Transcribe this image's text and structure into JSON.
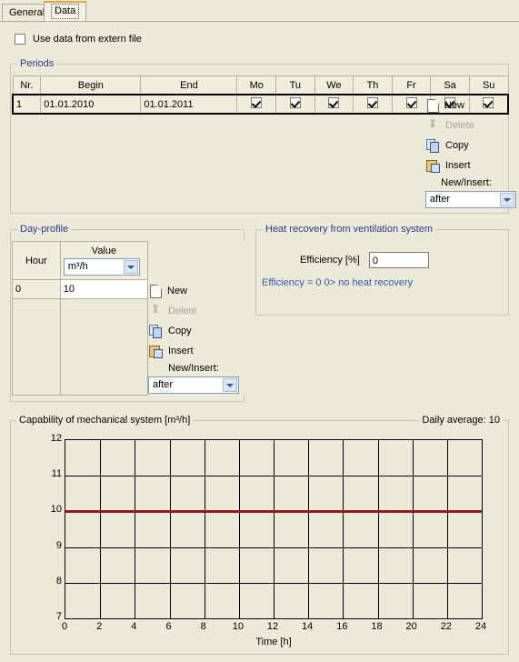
{
  "tabs": [
    {
      "label": "General",
      "active": false
    },
    {
      "label": "Data",
      "active": true
    }
  ],
  "extern": {
    "label": "Use data from extern file",
    "checked": false
  },
  "periods": {
    "legend": "Periods",
    "columns": [
      "Nr.",
      "Begin",
      "End",
      "Mo",
      "Tu",
      "We",
      "Th",
      "Fr",
      "Sa",
      "Su"
    ],
    "rows": [
      {
        "nr": "1",
        "begin": "01.01.2010",
        "end": "01.01.2011",
        "days": [
          true,
          true,
          true,
          true,
          true,
          true,
          true
        ],
        "selected": true
      }
    ],
    "actions": [
      {
        "label": "New",
        "icon": "new-page-icon",
        "enabled": true
      },
      {
        "label": "Delete",
        "icon": "scissors-icon",
        "enabled": false
      },
      {
        "label": "Copy",
        "icon": "copy-icon",
        "enabled": true
      },
      {
        "label": "Insert",
        "icon": "clipboard-insert-icon",
        "enabled": true
      }
    ],
    "new_insert_label": "New/Insert:",
    "new_insert_value": "after"
  },
  "dayprofile": {
    "legend": "Day-profile",
    "columns": [
      "Hour",
      "Value"
    ],
    "unit_value": "m³/h",
    "rows": [
      {
        "hour": "0",
        "value": "10"
      }
    ],
    "actions": [
      {
        "label": "New",
        "icon": "new-page-icon",
        "enabled": true
      },
      {
        "label": "Delete",
        "icon": "scissors-icon",
        "enabled": false
      },
      {
        "label": "Copy",
        "icon": "copy-icon",
        "enabled": true
      },
      {
        "label": "Insert",
        "icon": "clipboard-insert-icon",
        "enabled": true
      }
    ],
    "new_insert_label": "New/Insert:",
    "new_insert_value": "after"
  },
  "heat_recovery": {
    "legend": "Heat recovery from ventilation system",
    "efficiency_label": "Efficiency  [%]",
    "efficiency_value": "0",
    "note": "Efficiency = 0 0> no heat recovery"
  },
  "chart_panel": {
    "title": "Capability of mechanical system [m³/h]",
    "daily_average_label": "Daily average: 10"
  },
  "chart_data": {
    "type": "line",
    "title": "Capability of mechanical system [m³/h]",
    "xlabel": "Time [h]",
    "ylabel": "",
    "xlim": [
      0,
      24
    ],
    "ylim": [
      7,
      12
    ],
    "xticks": [
      0,
      2,
      4,
      6,
      8,
      10,
      12,
      14,
      16,
      18,
      20,
      22,
      24
    ],
    "yticks": [
      7,
      8,
      9,
      10,
      11,
      12
    ],
    "grid": true,
    "legend": "none",
    "series": [
      {
        "name": "Capability of mechanical system",
        "color": "#8c1a1a",
        "x": [
          0,
          24
        ],
        "values": [
          10,
          10
        ]
      }
    ],
    "annotations": [
      "Daily average: 10"
    ]
  },
  "colors": {
    "window_bg": "#ece9d8",
    "group_legend": "#2a3b8f",
    "active_tab_accent": "#e8a33d",
    "series": "#8c1a1a",
    "note_text": "#2a5ea8"
  }
}
